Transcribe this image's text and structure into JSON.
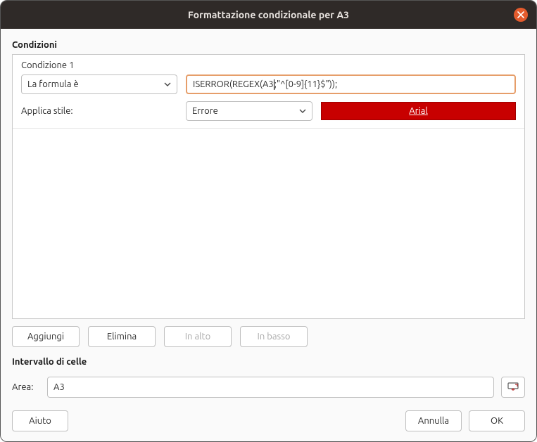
{
  "window": {
    "title": "Formattazione condizionale per A3"
  },
  "sections": {
    "conditions_label": "Condizioni",
    "range_label": "Intervallo di celle"
  },
  "condition": {
    "title": "Condizione 1",
    "type_dropdown": "La formula è",
    "formula_before": "ISERROR(REGEX(A3",
    "formula_after": ";\"^[0-9]{11}$\"));",
    "apply_style_label": "Applica stile:",
    "style_dropdown": "Errore",
    "preview_text": "Arial"
  },
  "buttons": {
    "add": "Aggiungi",
    "delete": "Elimina",
    "up": "In alto",
    "down": "In basso",
    "help": "Aiuto",
    "cancel": "Annulla",
    "ok": "OK"
  },
  "range": {
    "area_label": "Area:",
    "area_value": "A3"
  }
}
